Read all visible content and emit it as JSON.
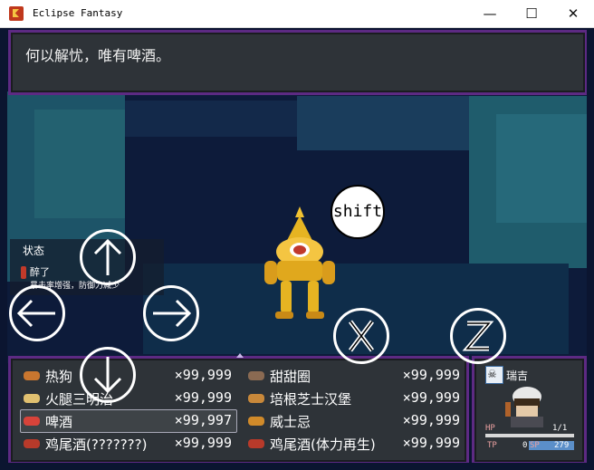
{
  "window": {
    "title": "Eclipse Fantasy",
    "minimize_glyph": "—",
    "maximize_glyph": "☐",
    "close_glyph": "✕"
  },
  "message": {
    "text": "何以解忧，唯有啤酒。"
  },
  "status": {
    "title": "状态",
    "effect_name": "醉了",
    "effect_desc": "暴击率增强，防御力减少"
  },
  "items": [
    {
      "name": "热狗",
      "qty": "×99,999",
      "icon": "hotdog-icon"
    },
    {
      "name": "甜甜圈",
      "qty": "×99,999",
      "icon": "donut-icon"
    },
    {
      "name": "火腿三明治",
      "qty": "×99,999",
      "icon": "sandwich-icon"
    },
    {
      "name": "培根芝士汉堡",
      "qty": "×99,999",
      "icon": "burger-icon"
    },
    {
      "name": "啤酒",
      "qty": "×99,997",
      "icon": "beer-icon"
    },
    {
      "name": "威士忌",
      "qty": "×99,999",
      "icon": "whiskey-icon"
    },
    {
      "name": "鸡尾酒(???????)",
      "qty": "×99,999",
      "icon": "cocktail-icon"
    },
    {
      "name": "鸡尾酒(体力再生)",
      "qty": "×99,999",
      "icon": "cocktail-icon"
    }
  ],
  "actor": {
    "name": "瑞吉",
    "hp_label": "HP",
    "hp_value": "1/1",
    "hp_fraction": 1.0,
    "tp_label": "TP",
    "tp_value": "0",
    "sp_label": "SP",
    "sp_value": "279"
  },
  "controls": {
    "shift_label": "shift"
  },
  "colors": {
    "window_border": "#5d2a83",
    "window_bg": "#2e3338",
    "hp_bar": "#d8d8d8",
    "sp_bar": "#5b8fc9"
  }
}
